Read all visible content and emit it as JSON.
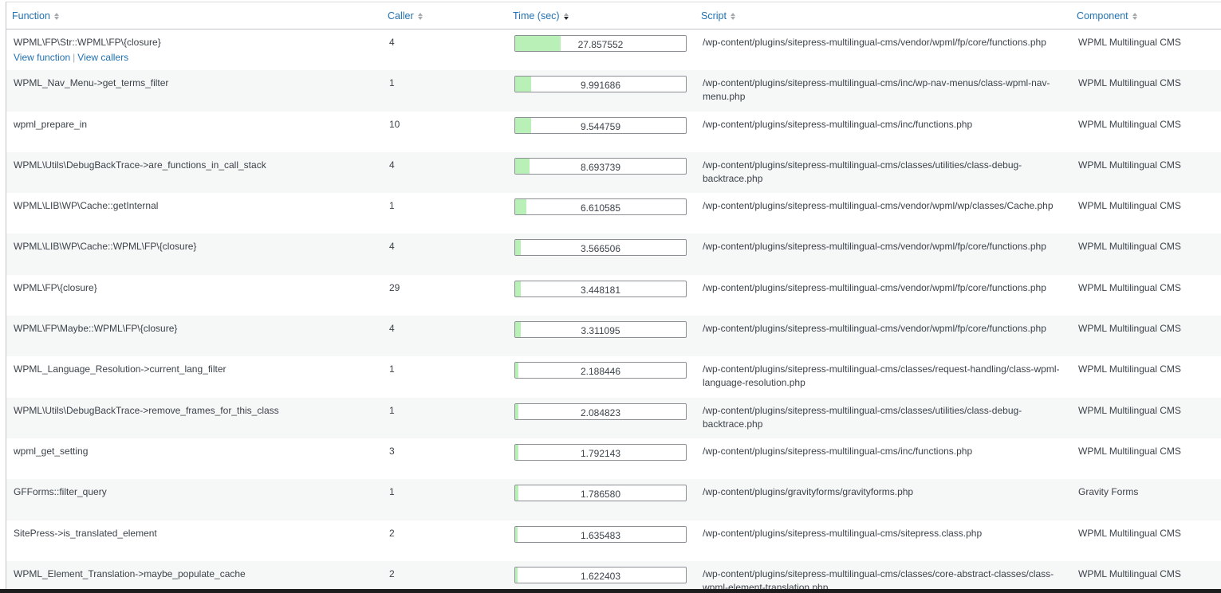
{
  "columns": {
    "function": "Function",
    "caller": "Caller",
    "time": "Time (sec)",
    "script": "Script",
    "component": "Component"
  },
  "actions": {
    "view_function": "View function",
    "separator": "|",
    "view_callers": "View callers"
  },
  "colors": {
    "bar_fill": "#b8f0b8",
    "link": "#2271b1"
  },
  "max_time": 27.857552,
  "rows": [
    {
      "function": "WPML\\FP\\Str::WPML\\FP\\{closure}",
      "caller": "4",
      "time": "27.857552",
      "script": "/wp-content/plugins/sitepress-multilingual-cms/vendor/wpml/fp/core/functions.php",
      "component": "WPML Multilingual CMS"
    },
    {
      "function": "WPML_Nav_Menu->get_terms_filter",
      "caller": "1",
      "time": "9.991686",
      "script": "/wp-content/plugins/sitepress-multilingual-cms/inc/wp-nav-menus/class-wpml-nav-menu.php",
      "component": "WPML Multilingual CMS"
    },
    {
      "function": "wpml_prepare_in",
      "caller": "10",
      "time": "9.544759",
      "script": "/wp-content/plugins/sitepress-multilingual-cms/inc/functions.php",
      "component": "WPML Multilingual CMS"
    },
    {
      "function": "WPML\\Utils\\DebugBackTrace->are_functions_in_call_stack",
      "caller": "4",
      "time": "8.693739",
      "script": "/wp-content/plugins/sitepress-multilingual-cms/classes/utilities/class-debug-backtrace.php",
      "component": "WPML Multilingual CMS"
    },
    {
      "function": "WPML\\LIB\\WP\\Cache::getInternal",
      "caller": "1",
      "time": "6.610585",
      "script": "/wp-content/plugins/sitepress-multilingual-cms/vendor/wpml/wp/classes/Cache.php",
      "component": "WPML Multilingual CMS"
    },
    {
      "function": "WPML\\LIB\\WP\\Cache::WPML\\FP\\{closure}",
      "caller": "4",
      "time": "3.566506",
      "script": "/wp-content/plugins/sitepress-multilingual-cms/vendor/wpml/fp/core/functions.php",
      "component": "WPML Multilingual CMS"
    },
    {
      "function": "WPML\\FP\\{closure}",
      "caller": "29",
      "time": "3.448181",
      "script": "/wp-content/plugins/sitepress-multilingual-cms/vendor/wpml/fp/core/functions.php",
      "component": "WPML Multilingual CMS"
    },
    {
      "function": "WPML\\FP\\Maybe::WPML\\FP\\{closure}",
      "caller": "4",
      "time": "3.311095",
      "script": "/wp-content/plugins/sitepress-multilingual-cms/vendor/wpml/fp/core/functions.php",
      "component": "WPML Multilingual CMS"
    },
    {
      "function": "WPML_Language_Resolution->current_lang_filter",
      "caller": "1",
      "time": "2.188446",
      "script": "/wp-content/plugins/sitepress-multilingual-cms/classes/request-handling/class-wpml-language-resolution.php",
      "component": "WPML Multilingual CMS"
    },
    {
      "function": "WPML\\Utils\\DebugBackTrace->remove_frames_for_this_class",
      "caller": "1",
      "time": "2.084823",
      "script": "/wp-content/plugins/sitepress-multilingual-cms/classes/utilities/class-debug-backtrace.php",
      "component": "WPML Multilingual CMS"
    },
    {
      "function": "wpml_get_setting",
      "caller": "3",
      "time": "1.792143",
      "script": "/wp-content/plugins/sitepress-multilingual-cms/inc/functions.php",
      "component": "WPML Multilingual CMS"
    },
    {
      "function": "GFForms::filter_query",
      "caller": "1",
      "time": "1.786580",
      "script": "/wp-content/plugins/gravityforms/gravityforms.php",
      "component": "Gravity Forms"
    },
    {
      "function": "SitePress->is_translated_element",
      "caller": "2",
      "time": "1.635483",
      "script": "/wp-content/plugins/sitepress-multilingual-cms/sitepress.class.php",
      "component": "WPML Multilingual CMS"
    },
    {
      "function": "WPML_Element_Translation->maybe_populate_cache",
      "caller": "2",
      "time": "1.622403",
      "script": "/wp-content/plugins/sitepress-multilingual-cms/classes/core-abstract-classes/class-wpml-element-translation.php",
      "component": "WPML Multilingual CMS"
    }
  ]
}
